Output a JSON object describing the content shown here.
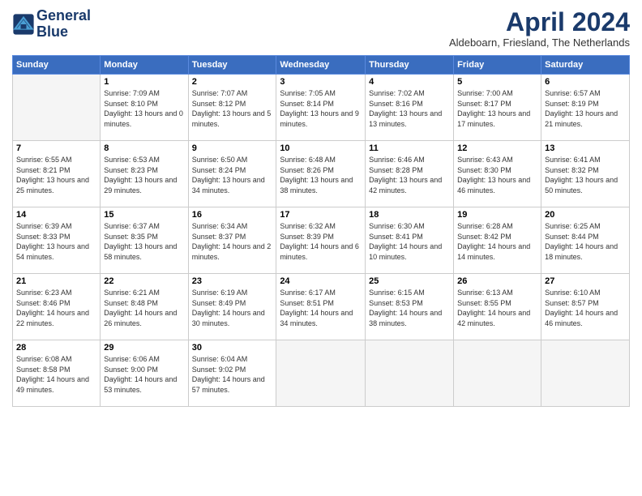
{
  "logo": {
    "line1": "General",
    "line2": "Blue"
  },
  "title": "April 2024",
  "location": "Aldeboarn, Friesland, The Netherlands",
  "days_header": [
    "Sunday",
    "Monday",
    "Tuesday",
    "Wednesday",
    "Thursday",
    "Friday",
    "Saturday"
  ],
  "weeks": [
    [
      {
        "day": "",
        "empty": true
      },
      {
        "day": "1",
        "sunrise": "7:09 AM",
        "sunset": "8:10 PM",
        "daylight": "13 hours and 0 minutes."
      },
      {
        "day": "2",
        "sunrise": "7:07 AM",
        "sunset": "8:12 PM",
        "daylight": "13 hours and 5 minutes."
      },
      {
        "day": "3",
        "sunrise": "7:05 AM",
        "sunset": "8:14 PM",
        "daylight": "13 hours and 9 minutes."
      },
      {
        "day": "4",
        "sunrise": "7:02 AM",
        "sunset": "8:16 PM",
        "daylight": "13 hours and 13 minutes."
      },
      {
        "day": "5",
        "sunrise": "7:00 AM",
        "sunset": "8:17 PM",
        "daylight": "13 hours and 17 minutes."
      },
      {
        "day": "6",
        "sunrise": "6:57 AM",
        "sunset": "8:19 PM",
        "daylight": "13 hours and 21 minutes."
      }
    ],
    [
      {
        "day": "7",
        "sunrise": "6:55 AM",
        "sunset": "8:21 PM",
        "daylight": "13 hours and 25 minutes."
      },
      {
        "day": "8",
        "sunrise": "6:53 AM",
        "sunset": "8:23 PM",
        "daylight": "13 hours and 29 minutes."
      },
      {
        "day": "9",
        "sunrise": "6:50 AM",
        "sunset": "8:24 PM",
        "daylight": "13 hours and 34 minutes."
      },
      {
        "day": "10",
        "sunrise": "6:48 AM",
        "sunset": "8:26 PM",
        "daylight": "13 hours and 38 minutes."
      },
      {
        "day": "11",
        "sunrise": "6:46 AM",
        "sunset": "8:28 PM",
        "daylight": "13 hours and 42 minutes."
      },
      {
        "day": "12",
        "sunrise": "6:43 AM",
        "sunset": "8:30 PM",
        "daylight": "13 hours and 46 minutes."
      },
      {
        "day": "13",
        "sunrise": "6:41 AM",
        "sunset": "8:32 PM",
        "daylight": "13 hours and 50 minutes."
      }
    ],
    [
      {
        "day": "14",
        "sunrise": "6:39 AM",
        "sunset": "8:33 PM",
        "daylight": "13 hours and 54 minutes."
      },
      {
        "day": "15",
        "sunrise": "6:37 AM",
        "sunset": "8:35 PM",
        "daylight": "13 hours and 58 minutes."
      },
      {
        "day": "16",
        "sunrise": "6:34 AM",
        "sunset": "8:37 PM",
        "daylight": "14 hours and 2 minutes."
      },
      {
        "day": "17",
        "sunrise": "6:32 AM",
        "sunset": "8:39 PM",
        "daylight": "14 hours and 6 minutes."
      },
      {
        "day": "18",
        "sunrise": "6:30 AM",
        "sunset": "8:41 PM",
        "daylight": "14 hours and 10 minutes."
      },
      {
        "day": "19",
        "sunrise": "6:28 AM",
        "sunset": "8:42 PM",
        "daylight": "14 hours and 14 minutes."
      },
      {
        "day": "20",
        "sunrise": "6:25 AM",
        "sunset": "8:44 PM",
        "daylight": "14 hours and 18 minutes."
      }
    ],
    [
      {
        "day": "21",
        "sunrise": "6:23 AM",
        "sunset": "8:46 PM",
        "daylight": "14 hours and 22 minutes."
      },
      {
        "day": "22",
        "sunrise": "6:21 AM",
        "sunset": "8:48 PM",
        "daylight": "14 hours and 26 minutes."
      },
      {
        "day": "23",
        "sunrise": "6:19 AM",
        "sunset": "8:49 PM",
        "daylight": "14 hours and 30 minutes."
      },
      {
        "day": "24",
        "sunrise": "6:17 AM",
        "sunset": "8:51 PM",
        "daylight": "14 hours and 34 minutes."
      },
      {
        "day": "25",
        "sunrise": "6:15 AM",
        "sunset": "8:53 PM",
        "daylight": "14 hours and 38 minutes."
      },
      {
        "day": "26",
        "sunrise": "6:13 AM",
        "sunset": "8:55 PM",
        "daylight": "14 hours and 42 minutes."
      },
      {
        "day": "27",
        "sunrise": "6:10 AM",
        "sunset": "8:57 PM",
        "daylight": "14 hours and 46 minutes."
      }
    ],
    [
      {
        "day": "28",
        "sunrise": "6:08 AM",
        "sunset": "8:58 PM",
        "daylight": "14 hours and 49 minutes."
      },
      {
        "day": "29",
        "sunrise": "6:06 AM",
        "sunset": "9:00 PM",
        "daylight": "14 hours and 53 minutes."
      },
      {
        "day": "30",
        "sunrise": "6:04 AM",
        "sunset": "9:02 PM",
        "daylight": "14 hours and 57 minutes."
      },
      {
        "day": "",
        "empty": true
      },
      {
        "day": "",
        "empty": true
      },
      {
        "day": "",
        "empty": true
      },
      {
        "day": "",
        "empty": true
      }
    ]
  ],
  "labels": {
    "sunrise": "Sunrise:",
    "sunset": "Sunset:",
    "daylight": "Daylight:"
  }
}
